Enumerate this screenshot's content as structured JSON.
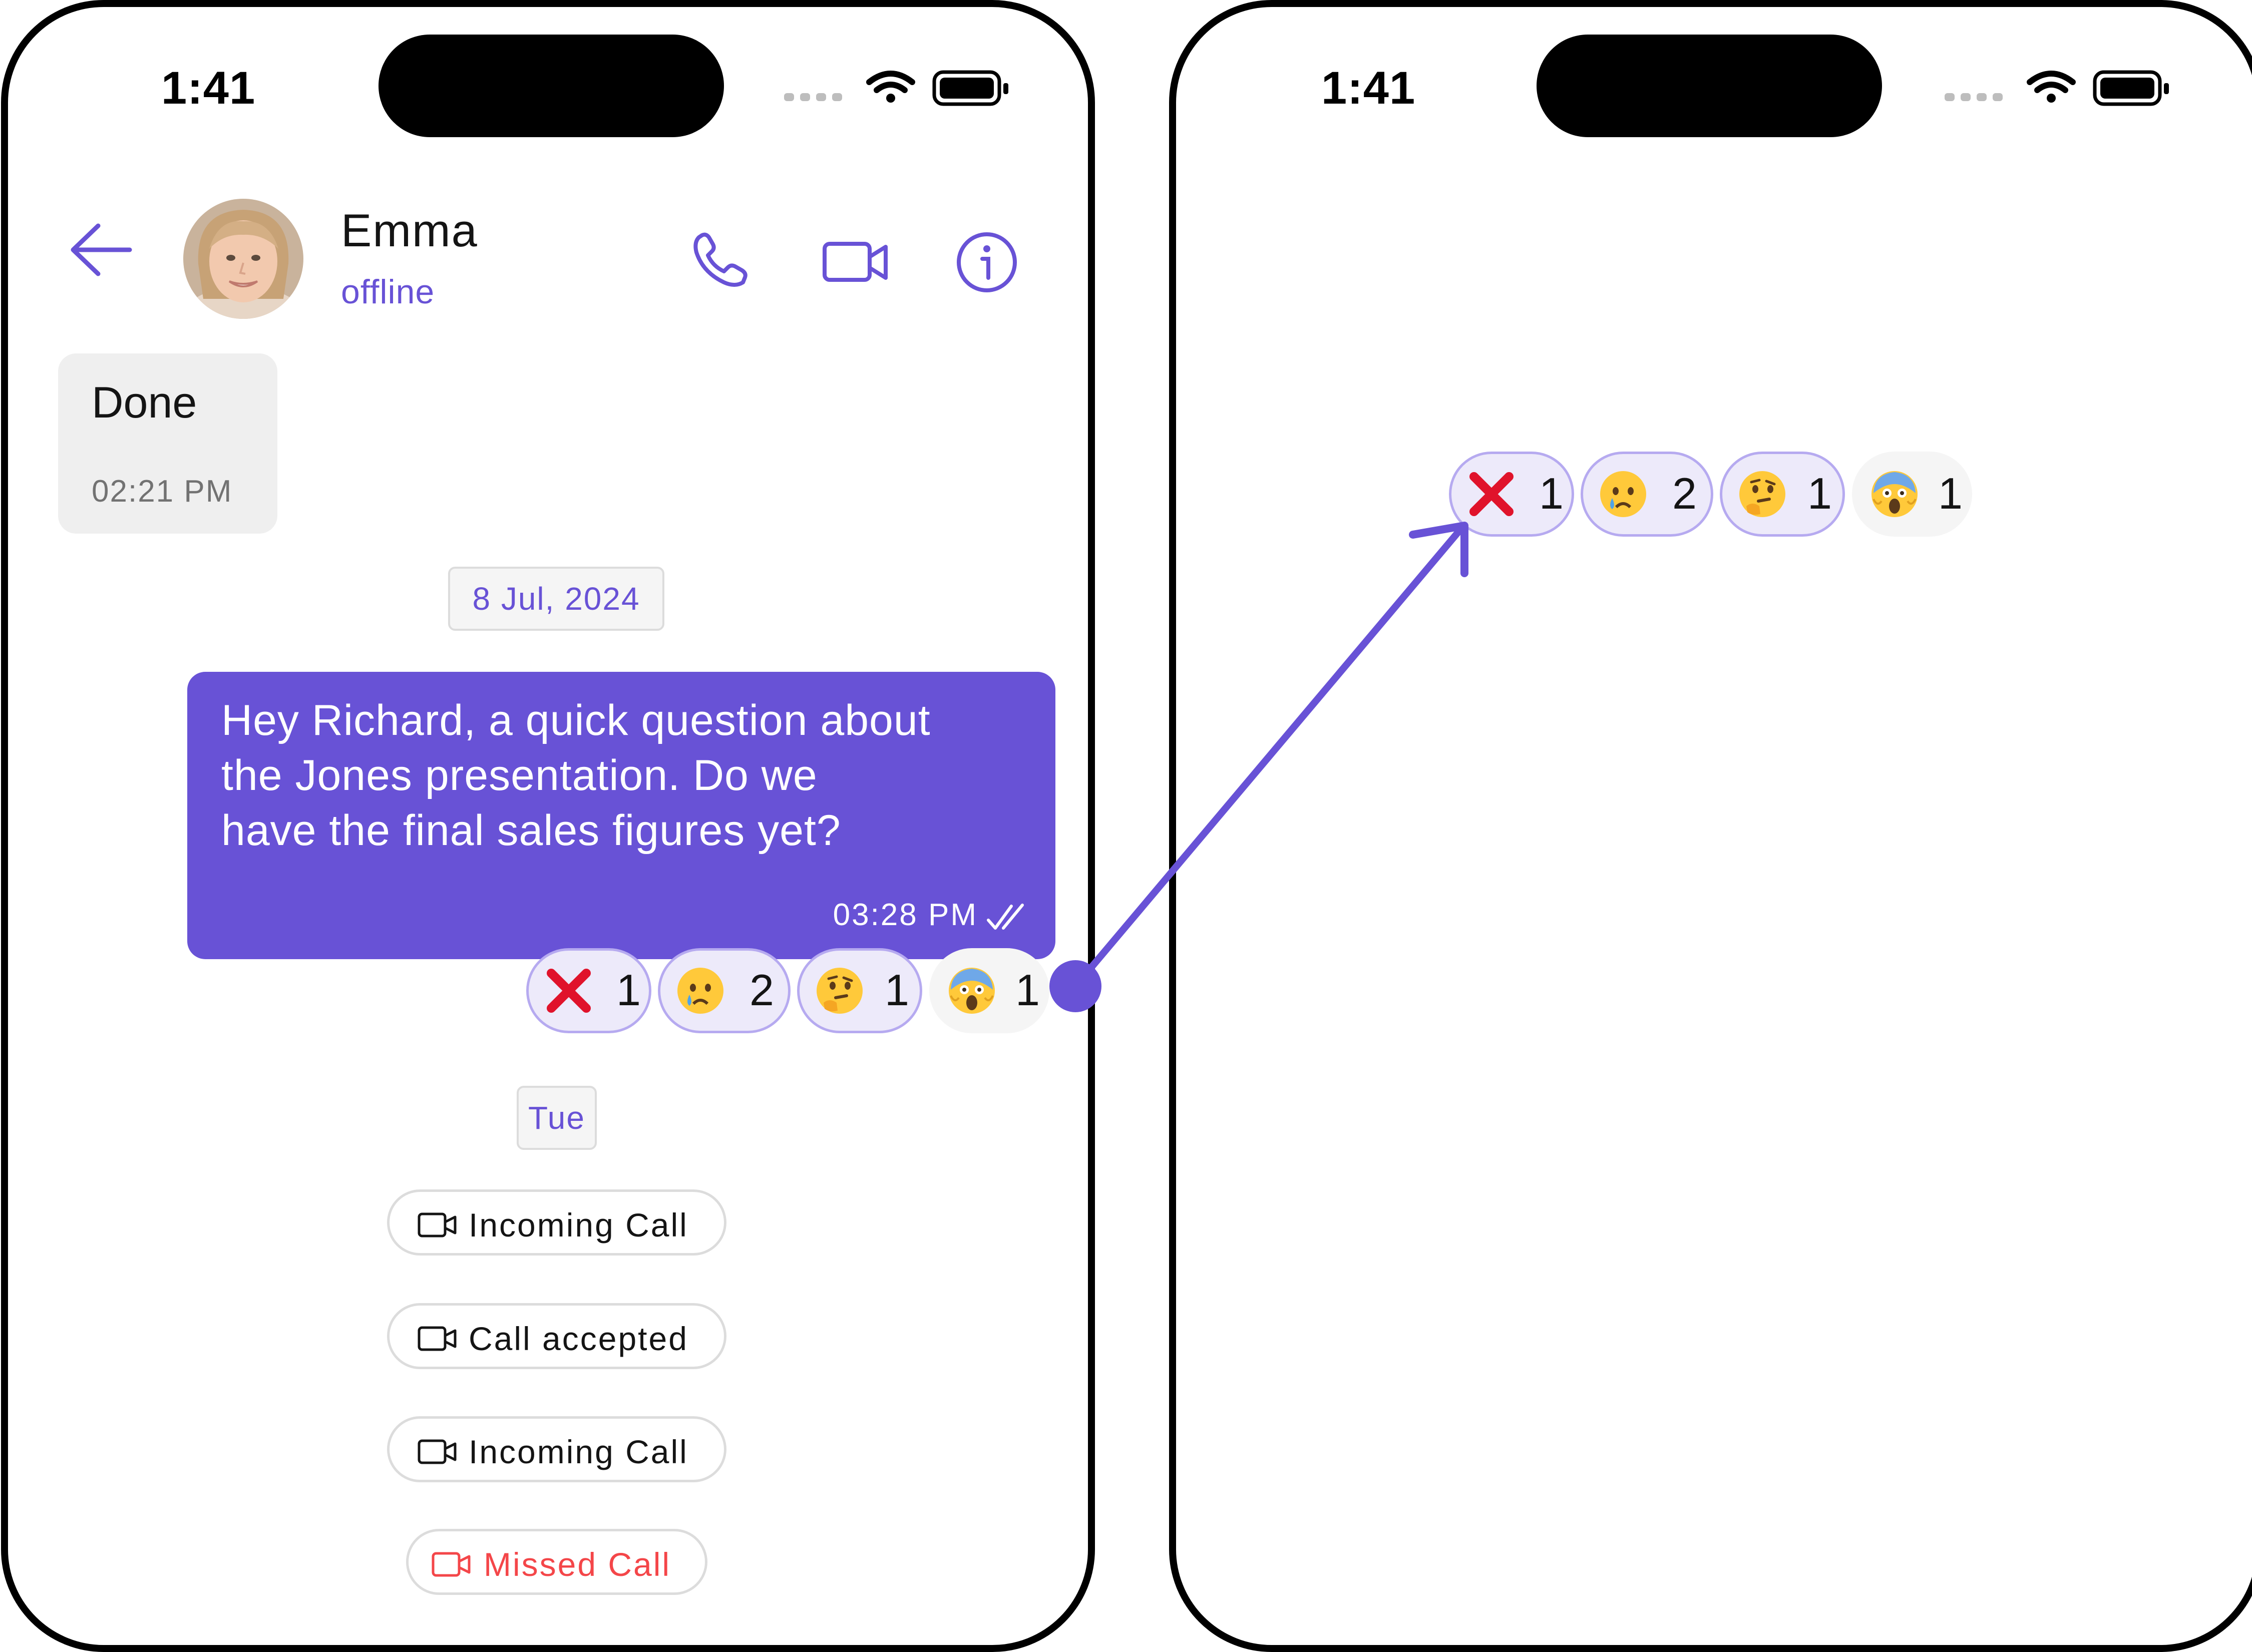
{
  "status_bar": {
    "time": "1:41"
  },
  "header": {
    "name": "Emma",
    "status": "offline"
  },
  "icons": {
    "back": "back-arrow-icon",
    "phone": "phone-icon",
    "video": "video-icon",
    "info": "info-icon",
    "wifi": "wifi-icon",
    "battery": "battery-icon",
    "signal": "signal-icon"
  },
  "colors": {
    "accent": "#6852D6",
    "missed": "#F44649",
    "incoming_bg": "#EFEFEF"
  },
  "messages": {
    "incoming": {
      "text": "Done",
      "time": "02:21 PM"
    },
    "date_separator_1": "8 Jul, 2024",
    "outgoing": {
      "lines": [
        "Hey Richard, a quick question about",
        "the Jones presentation.  Do we",
        "have the final sales figures yet?"
      ],
      "time": "03:28 PM",
      "receipt": "read"
    },
    "date_separator_2": "Tue"
  },
  "reactions": [
    {
      "emoji": "cross-mark",
      "count": "1",
      "selected": true
    },
    {
      "emoji": "crying-face",
      "count": "2",
      "selected": true
    },
    {
      "emoji": "thinking-face",
      "count": "1",
      "selected": true
    },
    {
      "emoji": "screaming-face",
      "count": "1",
      "selected": false
    }
  ],
  "calls": [
    {
      "label": "Incoming Call",
      "type": "incoming"
    },
    {
      "label": "Call accepted",
      "type": "accepted"
    },
    {
      "label": "Incoming Call",
      "type": "incoming"
    },
    {
      "label": "Missed Call",
      "type": "missed"
    }
  ]
}
